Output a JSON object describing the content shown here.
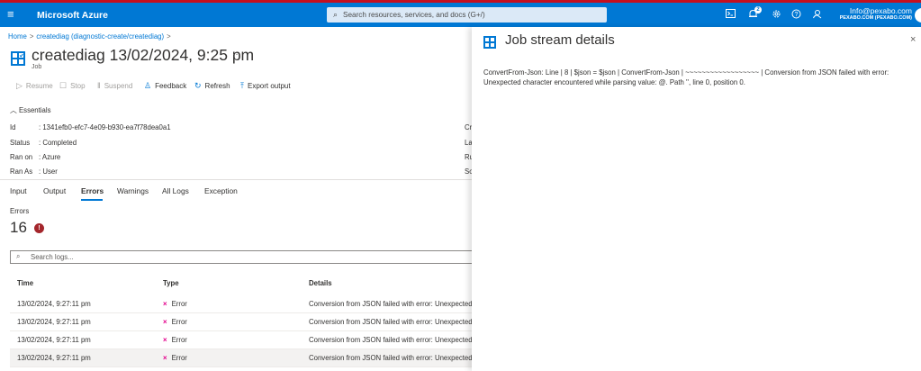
{
  "colors": {
    "accent": "#0078d4",
    "error": "#a4262c",
    "error_x": "#e3008c",
    "top_strip": "#c50f1f"
  },
  "topbar": {
    "brand": "Microsoft Azure",
    "search_placeholder": "Search resources, services, and docs (G+/)",
    "notification_count": "2",
    "account_email": "Info@pexabo.com",
    "account_org": "PEXABO.COM (PEXABO.COM)",
    "icons": [
      "menu-icon",
      "search-icon",
      "cloud-shell-icon",
      "notifications-icon",
      "settings-icon",
      "help-icon",
      "feedback-icon"
    ]
  },
  "breadcrumb": {
    "home": "Home",
    "sep": ">",
    "item": "creatediag (diagnostic-create/creatediag)",
    "trail_sep": ">"
  },
  "header": {
    "title": "creatediag 13/02/2024, 9:25 pm",
    "more": "···",
    "subtitle": "Job"
  },
  "commands": {
    "resume": "Resume",
    "stop": "Stop",
    "suspend": "Suspend",
    "feedback": "Feedback",
    "refresh": "Refresh",
    "export": "Export output"
  },
  "essentials": {
    "label": "Essentials",
    "props": [
      {
        "key": "Id",
        "value": ": 1341efb0-efc7-4e09-b930-ea7f78dea0a1",
        "right": "Cr"
      },
      {
        "key": "Status",
        "value": ": Completed",
        "right": "La"
      },
      {
        "key": "Ran on",
        "value": ": Azure",
        "right": "Ru"
      },
      {
        "key": "Ran As",
        "value": ": User",
        "right": "So"
      }
    ]
  },
  "tabs": [
    "Input",
    "Output",
    "Errors",
    "Warnings",
    "All Logs",
    "Exception"
  ],
  "active_tab": "Errors",
  "errors": {
    "label": "Errors",
    "count": "16",
    "badge": "!"
  },
  "log_search": {
    "placeholder": "Search logs..."
  },
  "table": {
    "headers": {
      "time": "Time",
      "type": "Type",
      "details": "Details"
    },
    "rows": [
      {
        "time": "13/02/2024, 9:27:11 pm",
        "type": "Error",
        "details": "Conversion from JSON failed with error: Unexpected"
      },
      {
        "time": "13/02/2024, 9:27:11 pm",
        "type": "Error",
        "details": "Conversion from JSON failed with error: Unexpected"
      },
      {
        "time": "13/02/2024, 9:27:11 pm",
        "type": "Error",
        "details": "Conversion from JSON failed with error: Unexpected"
      },
      {
        "time": "13/02/2024, 9:27:11 pm",
        "type": "Error",
        "details": "Conversion from JSON failed with error: Unexpected"
      }
    ],
    "type_icon": "×"
  },
  "panel": {
    "title": "Job stream details",
    "close": "×",
    "body": "ConvertFrom-Json: Line | 8 | $json = $json | ConvertFrom-Json | ~~~~~~~~~~~~~~~~~~ | Conversion from JSON failed with error: Unexpected character encountered while parsing value: @. Path '', line 0, position 0."
  }
}
